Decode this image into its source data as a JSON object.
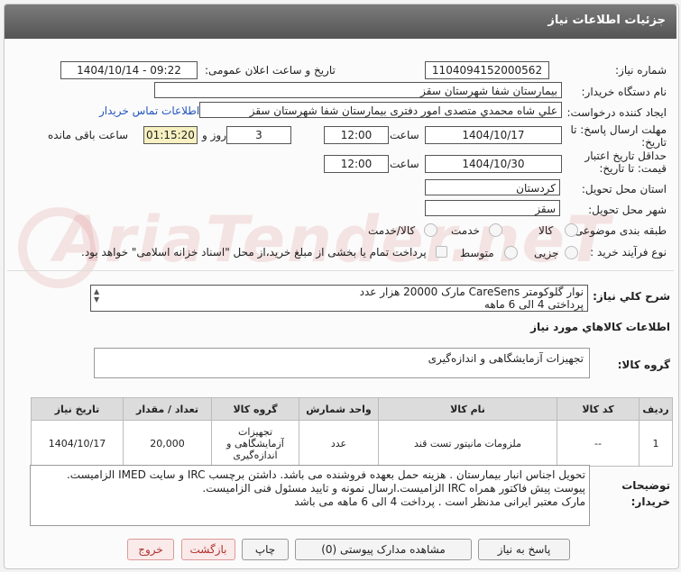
{
  "header": {
    "title": "جزئیات اطلاعات نیاز"
  },
  "fields": {
    "need_number_label": "شماره نیاز:",
    "need_number": "1104094152000562",
    "announce_label": "تاریخ و ساعت اعلان عمومی:",
    "announce_value": "1404/10/14 - 09:22",
    "buyer_org_label": "نام دستگاه خریدار:",
    "buyer_org": "بیمارستان شفا شهرستان سقز",
    "requester_label": "ایجاد کننده درخواست:",
    "requester": "علي شاه محمدي متصدی امور دفتری بیمارستان شفا شهرستان سقز",
    "contact_link": "اطلاعات تماس خریدار",
    "deadline_label": "مهلت ارسال پاسخ: تا تاریخ:",
    "deadline_date": "1404/10/17",
    "time_label": "ساعت",
    "deadline_time": "12:00",
    "days_value": "3",
    "days_label": "روز و",
    "remaining_time": "01:15:20",
    "remaining_label": "ساعت باقی مانده",
    "min_price_label": "حداقل تاریخ اعتبار قیمت: تا تاریخ:",
    "min_price_date": "1404/10/30",
    "min_price_time": "12:00",
    "province_label": "استان محل تحویل:",
    "province": "کردستان",
    "city_label": "شهر محل تحویل:",
    "city": "سقز",
    "category_label": "طبقه بندی موضوعی:",
    "category_options": [
      "کالا",
      "خدمت",
      "کالا/خدمت"
    ],
    "process_label": "نوع فرآیند خرید :",
    "process_options": [
      "جزیی",
      "متوسط"
    ],
    "payment_note": "پرداخت تمام یا بخشی از مبلغ خرید،از محل \"اسناد خزانه اسلامی\" خواهد بود."
  },
  "summary": {
    "label": "شرح کلي نياز:",
    "line1": "نوار گلوکومتر CareSens  مارک  20000 هزار عدد",
    "line2": "پرداختی 4 الی 6 ماهه"
  },
  "goods_info_title": "اطلاعات کالاهاي مورد نياز",
  "goods_group": {
    "label": "گروه کالا:",
    "value": "تجهیزات آزمایشگاهی و اندازه‌گیری"
  },
  "table": {
    "headers": [
      "ردیف",
      "کد کالا",
      "نام کالا",
      "واحد شمارش",
      "گروه کالا",
      "تعداد / مقدار",
      "تاریخ نیاز"
    ],
    "rows": [
      [
        "1",
        "--",
        "ملزومات مانیتور تست قند",
        "عدد",
        "تجهیزات آزمایشگاهی و اندازه‌گیری",
        "20,000",
        "1404/10/17"
      ]
    ]
  },
  "buyer_notes": {
    "label": "توضیحات خریدار:",
    "line1": "تحویل اجناس  انبار بیمارستان . هزینه حمل بعهده فروشنده می باشد.  داشتن برچسب  IRC  و سایت  IMED  الزامیست.",
    "line2": "پیوست پیش فاکتور همراه  IRC  الزامیست.ارسال نمونه و تایید مسئول فنی الزامیست.",
    "line3": " مارک معتبر ایرانی مدنظر است . پرداخت 4 الی 6 ماهه می باشد"
  },
  "buttons": {
    "reply": "پاسخ به نیاز",
    "view_docs": "مشاهده مدارک پیوستی (0)",
    "print": "چاپ",
    "back": "بازگشت",
    "exit": "خروج"
  },
  "watermark": "AriaTender.neT"
}
